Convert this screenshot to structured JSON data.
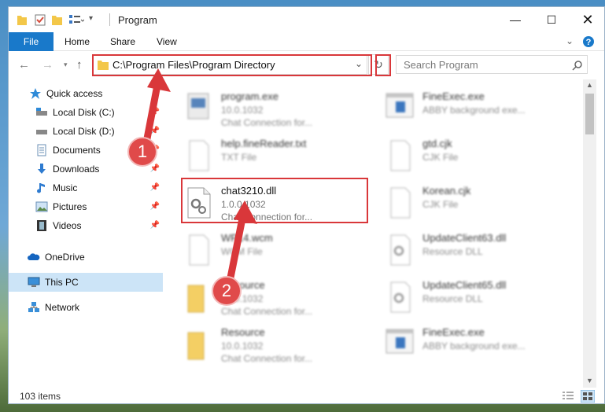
{
  "window": {
    "title": "Program"
  },
  "ribbon": {
    "tabs": [
      "File",
      "Home",
      "Share",
      "View"
    ]
  },
  "nav": {
    "address": "C:\\Program Files\\Program Directory",
    "search_placeholder": "Search Program"
  },
  "sidebar": {
    "items": [
      {
        "label": "Quick access"
      },
      {
        "label": "Local Disk (C:)"
      },
      {
        "label": "Local Disk (D:)"
      },
      {
        "label": "Documents"
      },
      {
        "label": "Downloads"
      },
      {
        "label": "Music"
      },
      {
        "label": "Pictures"
      },
      {
        "label": "Videos"
      },
      {
        "label": "OneDrive"
      },
      {
        "label": "This PC"
      },
      {
        "label": "Network"
      }
    ]
  },
  "files": [
    {
      "name": "program.exe",
      "line1": "10.0.1032",
      "line2": "Chat Connection for..."
    },
    {
      "name": "FineExec.exe",
      "line1": "ABBY background exe...",
      "line2": ""
    },
    {
      "name": "help.fineReader.txt",
      "line1": "TXT File",
      "line2": ""
    },
    {
      "name": "gtd.cjk",
      "line1": "CJK File",
      "line2": ""
    },
    {
      "name": "chat3210.dll",
      "line1": "1.0.0.1032",
      "line2": "Chat Connection for..."
    },
    {
      "name": "Korean.cjk",
      "line1": "CJK File",
      "line2": ""
    },
    {
      "name": "WP14.wcm",
      "line1": "WCM File",
      "line2": ""
    },
    {
      "name": "UpdateClient63.dll",
      "line1": "Resource DLL",
      "line2": ""
    },
    {
      "name": "Resource",
      "line1": "10.0.1032",
      "line2": "Chat Connection for..."
    },
    {
      "name": "UpdateClient65.dll",
      "line1": "Resource DLL",
      "line2": ""
    },
    {
      "name": "Resource",
      "line1": "10.0.1032",
      "line2": "Chat Connection for..."
    },
    {
      "name": "FineExec.exe",
      "line1": "ABBY background exe...",
      "line2": ""
    }
  ],
  "status": {
    "count": "103 items"
  },
  "annotations": {
    "step1": "1",
    "step2": "2"
  },
  "colors": {
    "accent": "#1979ca",
    "highlight": "#d9373a",
    "selection": "#cce4f7"
  }
}
